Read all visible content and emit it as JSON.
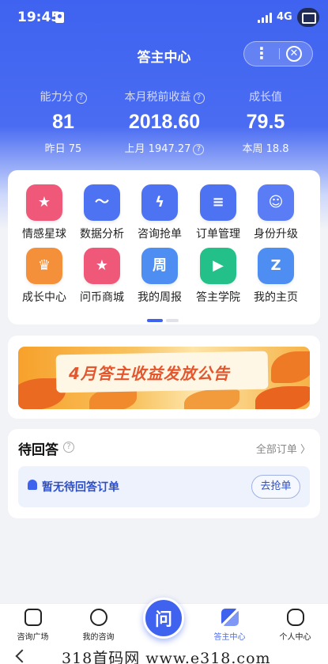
{
  "status_bar": {
    "time": "19:45",
    "network": "4G"
  },
  "header": {
    "title": "答主中心",
    "more_icon": "more-icon",
    "close_icon": "close-circle-icon"
  },
  "stats": [
    {
      "label": "能力分",
      "value": "81",
      "sub": "昨日 75",
      "help": true
    },
    {
      "label": "本月税前收益",
      "value": "2018.60",
      "sub": "上月 1947.27",
      "help": true
    },
    {
      "label": "成长值",
      "value": "79.5",
      "sub": "本周 18.8",
      "help": false
    }
  ],
  "grid": [
    {
      "label": "情感星球",
      "icon": "planet-heart-icon",
      "color": "#f0587a"
    },
    {
      "label": "数据分析",
      "icon": "chart-icon",
      "color": "#4e73f2"
    },
    {
      "label": "咨询抢单",
      "icon": "lightning-icon",
      "color": "#4e73f2"
    },
    {
      "label": "订单管理",
      "icon": "document-icon",
      "color": "#4e73f2"
    },
    {
      "label": "身份升级",
      "icon": "user-upgrade-icon",
      "color": "#5a7df5"
    },
    {
      "label": "成长中心",
      "icon": "crown-icon",
      "color": "#f5903a"
    },
    {
      "label": "问币商城",
      "icon": "shop-star-icon",
      "color": "#f0587a"
    },
    {
      "label": "我的周报",
      "icon": "calendar-icon",
      "color": "#4e8ef2"
    },
    {
      "label": "答主学院",
      "icon": "play-book-icon",
      "color": "#23c08a"
    },
    {
      "label": "我的主页",
      "icon": "home-profile-icon",
      "color": "#4e8ef2"
    }
  ],
  "grid_glyphs": [
    "★",
    "〜",
    "ϟ",
    "≡",
    "☺",
    "♛",
    "★",
    "周",
    "▶",
    "Z"
  ],
  "banner": {
    "title": "4月答主收益发放公告"
  },
  "pending": {
    "title": "待回答",
    "all_orders": "全部订单 〉",
    "empty_text": "暂无待回答订单",
    "grab_button": "去抢单"
  },
  "tabbar": {
    "tabs": [
      {
        "label": "咨询广场",
        "icon": "home-icon"
      },
      {
        "label": "我的咨询",
        "icon": "chat-icon"
      },
      {
        "label": "答主中心",
        "icon": "grid-icon",
        "active": true
      },
      {
        "label": "个人中心",
        "icon": "profile-icon"
      }
    ],
    "center_button": "问"
  },
  "watermark": "318首码网 www.e318.com",
  "colors": {
    "primary": "#3f62ef",
    "active_tab": "#4a6cf2"
  }
}
